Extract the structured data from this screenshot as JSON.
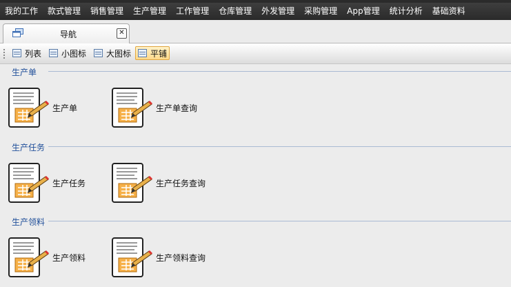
{
  "menubar": {
    "items": [
      "我的工作",
      "款式管理",
      "销售管理",
      "生产管理",
      "工作管理",
      "仓库管理",
      "外发管理",
      "采购管理",
      "App管理",
      "统计分析",
      "基础资料"
    ]
  },
  "tab": {
    "label": "导航",
    "close_label": "✕"
  },
  "viewbar": {
    "list": "列表",
    "small_icon": "小图标",
    "large_icon": "大图标",
    "tile": "平铺",
    "active": "平铺"
  },
  "sections": [
    {
      "title": "生产单",
      "items": [
        "生产单",
        "生产单查询"
      ]
    },
    {
      "title": "生产任务",
      "items": [
        "生产任务",
        "生产任务查询"
      ]
    },
    {
      "title": "生产领料",
      "items": [
        "生产领料",
        "生产领料查询"
      ]
    }
  ],
  "colors": {
    "menubar": "#2f2f2f",
    "section_title": "#1f4e99",
    "active_view": "#ffd98a"
  }
}
